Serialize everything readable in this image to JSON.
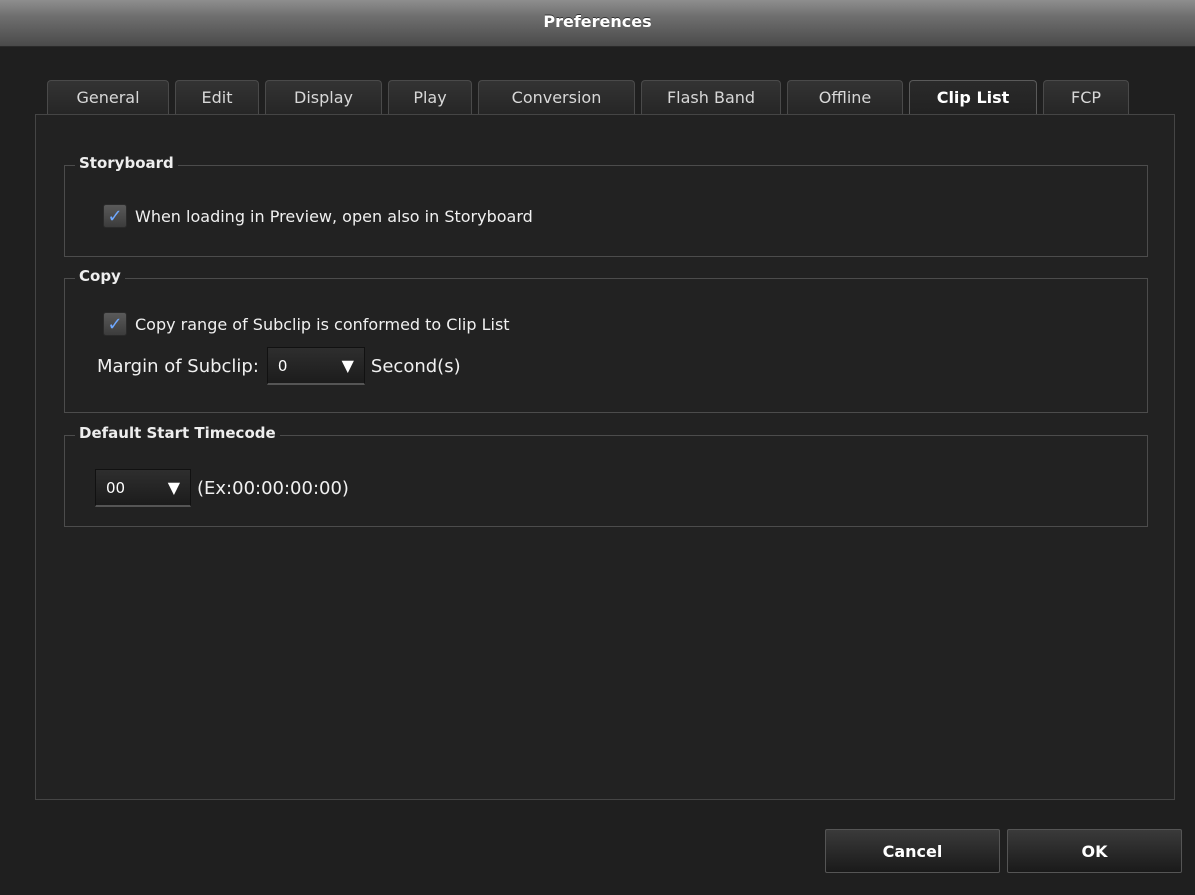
{
  "window": {
    "title": "Preferences"
  },
  "tabs": [
    {
      "label": "General",
      "active": false
    },
    {
      "label": "Edit",
      "active": false
    },
    {
      "label": "Display",
      "active": false
    },
    {
      "label": "Play",
      "active": false
    },
    {
      "label": "Conversion",
      "active": false
    },
    {
      "label": "Flash Band",
      "active": false
    },
    {
      "label": "Offline",
      "active": false
    },
    {
      "label": "Clip List",
      "active": true
    },
    {
      "label": "FCP",
      "active": false
    }
  ],
  "storyboard": {
    "legend": "Storyboard",
    "open_in_storyboard": {
      "label": "When loading in Preview, open also in Storyboard",
      "checked": true
    }
  },
  "copy": {
    "legend": "Copy",
    "conform_range": {
      "label": "Copy range of Subclip is conformed to Clip List",
      "checked": true
    },
    "margin_label": "Margin of Subclip:",
    "margin_value": "0",
    "margin_unit": "Second(s)"
  },
  "timecode": {
    "legend": "Default Start Timecode",
    "hour_value": "00",
    "example": "(Ex:00:00:00:00)"
  },
  "buttons": {
    "cancel": "Cancel",
    "ok": "OK"
  },
  "icons": {
    "check": "checkmark-icon",
    "dropdown": "triangle-down-icon"
  },
  "colors": {
    "check_accent": "#6fa8ff",
    "background": "#1f1f1f"
  }
}
